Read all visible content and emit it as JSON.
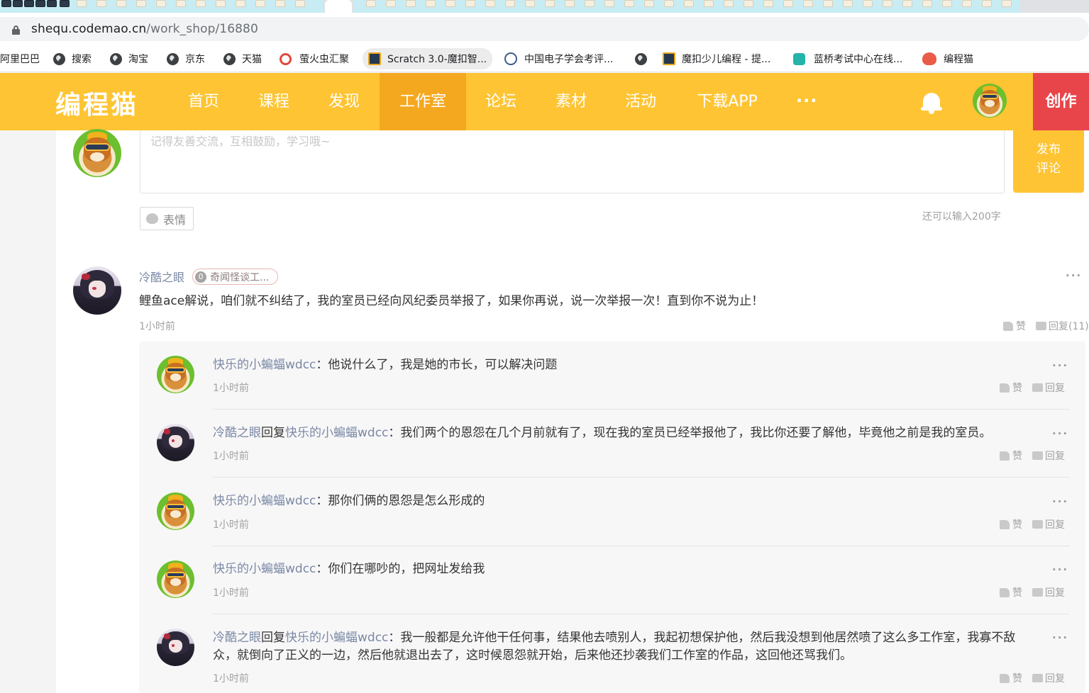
{
  "browser": {
    "url_host": "shequ.codemao.cn",
    "url_path": "/work_shop/16880",
    "bookmarks": [
      {
        "label": "阿里巴巴"
      },
      {
        "label": "搜索"
      },
      {
        "label": "淘宝"
      },
      {
        "label": "京东"
      },
      {
        "label": "天猫"
      },
      {
        "label": "萤火虫汇聚"
      },
      {
        "label": "Scratch 3.0-魔扣智..."
      },
      {
        "label": "中国电子学会考评..."
      },
      {
        "label": ""
      },
      {
        "label": "魔扣少儿编程 - 提..."
      },
      {
        "label": "蓝桥考试中心在线..."
      },
      {
        "label": "编程猫"
      }
    ]
  },
  "navbar": {
    "logo": "编程猫",
    "items": [
      "首页",
      "课程",
      "发现",
      "工作室",
      "论坛",
      "素材",
      "活动",
      "下载APP"
    ],
    "active": "工作室",
    "more": "···",
    "create": "创作",
    "colors": {
      "bar": "#fec433",
      "active": "#f4a81f",
      "create": "#e8454b"
    }
  },
  "composer": {
    "placeholder": "记得友善交流，互相鼓励，学习哦~",
    "publish_line1": "发布",
    "publish_line2": "评论",
    "emoji": "表情",
    "char_count": "还可以输入200字"
  },
  "comment": {
    "author": "冷酷之眼",
    "badge_num": "0",
    "badge_text": "奇闻怪谈工...",
    "text": "鲤鱼ace解说，咱们就不纠结了，我的室员已经向风纪委员举报了，如果你再说，说一次举报一次！直到你不说为止！",
    "time": "1小时前",
    "like": "赞",
    "reply": "回复(11)",
    "more": "···"
  },
  "replies": [
    {
      "avatar": "dog",
      "name": "快乐的小蝙蝠wdcc",
      "reply_word": "",
      "target": "",
      "text": "：他说什么了，我是她的市长，可以解决问题",
      "text2": "",
      "time": "1小时前",
      "like": "赞",
      "reply": "回复"
    },
    {
      "avatar": "anime",
      "name": "冷酷之眼",
      "reply_word": "回复",
      "target": "快乐的小蝙蝠wdcc",
      "text": "：我们两个的恩怨在几个月前就有了，现在我的室员已经举报他了，我比你还要了解他，毕竟他之前是我的室员。",
      "text2": "",
      "time": "1小时前",
      "like": "赞",
      "reply": "回复"
    },
    {
      "avatar": "dog",
      "name": "快乐的小蝙蝠wdcc",
      "reply_word": "",
      "target": "",
      "text": "：那你们俩的恩怨是怎么形成的",
      "text2": "",
      "time": "1小时前",
      "like": "赞",
      "reply": "回复"
    },
    {
      "avatar": "dog",
      "name": "快乐的小蝙蝠wdcc",
      "reply_word": "",
      "target": "",
      "text": "：你们在哪吵的，把网址发给我",
      "text2": "",
      "time": "1小时前",
      "like": "赞",
      "reply": "回复"
    },
    {
      "avatar": "anime",
      "name": "冷酷之眼",
      "reply_word": "回复",
      "target": "快乐的小蝙蝠wdcc",
      "text": "：我一般都是允许他干任何事，结果他去喷别人，我起初想保护他，然后我没想到他居然喷了这么多工作室，我寡不敌",
      "text2": "众，就倒向了正义的一边，然后他就退出去了，这时候恩怨就开始，后来他还抄袭我们工作室的作品，这回他还骂我们。",
      "time": "1小时前",
      "like": "赞",
      "reply": "回复"
    }
  ]
}
